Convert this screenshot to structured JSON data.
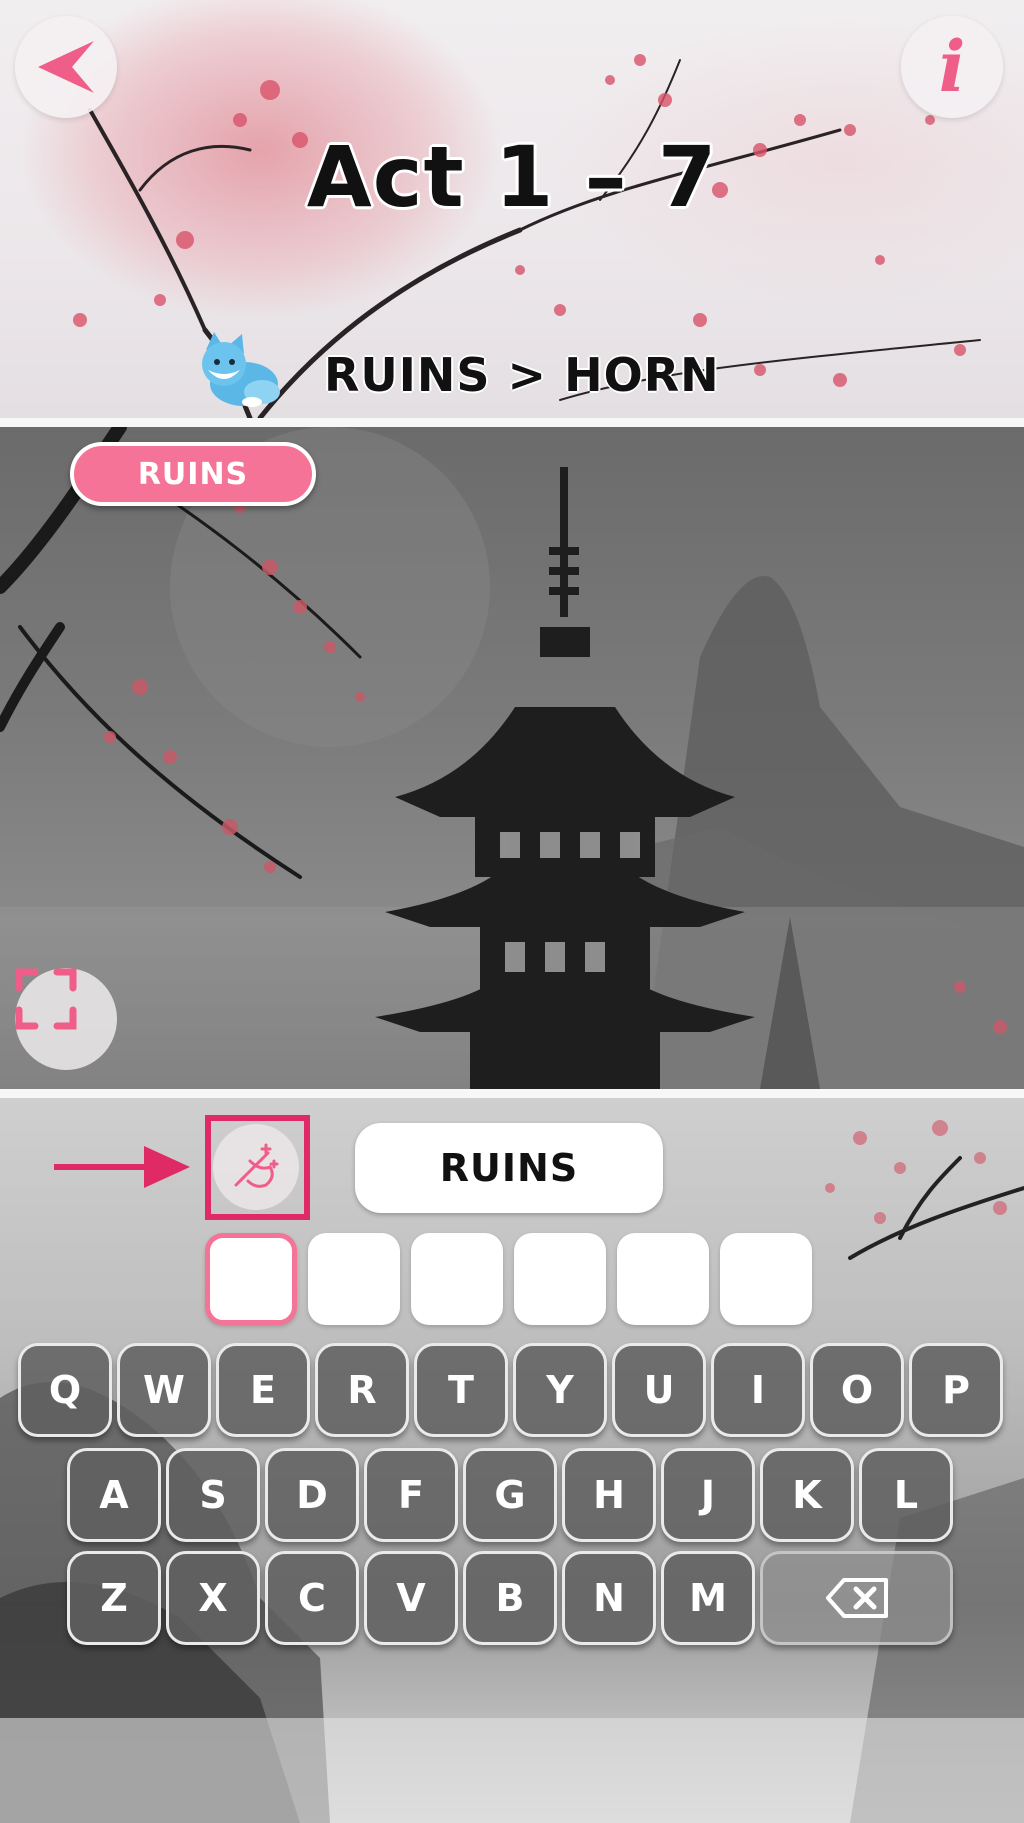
{
  "header": {
    "title": "Act 1 – 7",
    "puzzle_path": "RUINS > HORN",
    "back_icon": "back-arrow-icon",
    "info_icon": "info-icon",
    "info_glyph": "i",
    "mascot_icon": "fox-mascot-icon"
  },
  "scene": {
    "current_word": "RUINS",
    "expand_icon": "expand-icon"
  },
  "input": {
    "hint_icon": "hint-icon",
    "hint_pointer_icon": "arrow-right-icon",
    "answer_word": "RUINS",
    "slots": [
      "",
      "",
      "",
      "",
      "",
      ""
    ],
    "active_slot_index": 0
  },
  "keyboard": {
    "rows": [
      [
        "Q",
        "W",
        "E",
        "R",
        "T",
        "Y",
        "U",
        "I",
        "O",
        "P"
      ],
      [
        "A",
        "S",
        "D",
        "F",
        "G",
        "H",
        "J",
        "K",
        "L"
      ],
      [
        "Z",
        "X",
        "C",
        "V",
        "B",
        "N",
        "M"
      ]
    ],
    "backspace_icon": "backspace-icon"
  },
  "colors": {
    "accent_pink": "#f57396",
    "highlight_red": "#e02a66",
    "key_gray": "#5f5f5f"
  }
}
